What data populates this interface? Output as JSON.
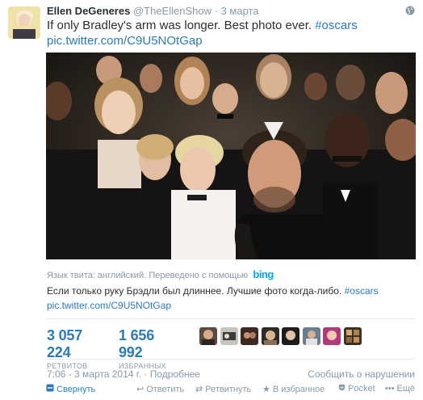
{
  "tweet": {
    "fullname": "Ellen DeGeneres",
    "handle": "@TheEllenShow",
    "separator": "·",
    "date_short": "3 марта",
    "text_main": "If only Bradley's arm was longer. Best photo ever.",
    "hashtag": "#oscars",
    "pic_link": "pic.twitter.com/C9U5NOtGap"
  },
  "translation": {
    "meta_label": "Язык твита: английский. Переведено с помощью",
    "bing_label": "bing",
    "translated_text": "Если только руку Брэдли был длиннее. Лучшие фото когда-либо.",
    "hashtag": "#oscars",
    "pic_link": "pic.twitter.com/C9U5NOtGap"
  },
  "stats": {
    "retweets_count": "3 057 224",
    "retweets_label": "РЕТВИТОВ",
    "favorites_count": "1 656 992",
    "favorites_label": "ИЗБРАННЫХ"
  },
  "footer": {
    "timestamp": "7:06 - 3 марта 2014 г.",
    "separator": "·",
    "details_link": "Подробнее",
    "report_link": "Сообщить о нарушении"
  },
  "actions": {
    "collapse": "Свернуть",
    "reply": "Ответить",
    "retweet": "Ретвитнуть",
    "favorite": "В избранное",
    "pocket": "Pocket",
    "more": "Ещё"
  },
  "colors": {
    "link": "#2b7bb9",
    "muted": "#8899a6",
    "text": "#292f33",
    "bing": "#00a6e6"
  }
}
